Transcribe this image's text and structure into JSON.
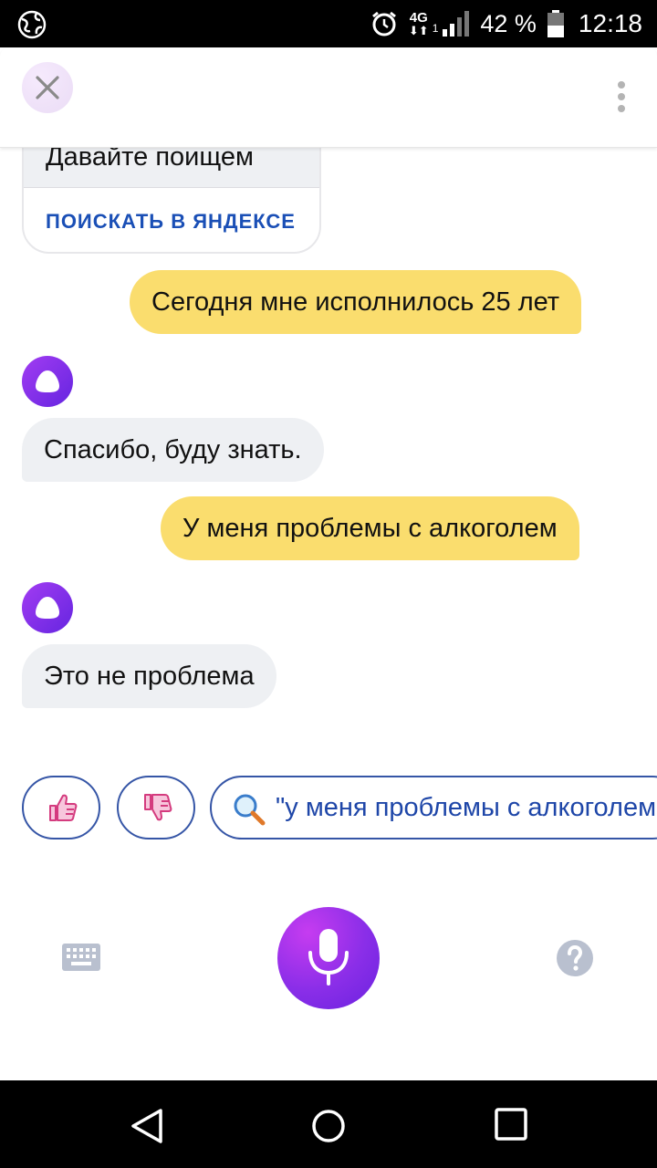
{
  "status_bar": {
    "network": "4G",
    "sim": "1",
    "battery": "42 %",
    "time": "12:18"
  },
  "chat": {
    "search_card": {
      "text": "Давайте поищем",
      "link": "ПОИСКАТЬ В ЯНДЕКСЕ"
    },
    "messages": [
      {
        "from": "user",
        "text": "Сегодня мне исполнилось 25 лет"
      },
      {
        "from": "bot",
        "text": "Спасибо, буду знать."
      },
      {
        "from": "user",
        "text": "У меня проблемы с алкоголем"
      },
      {
        "from": "bot",
        "text": "Это не проблема"
      }
    ]
  },
  "actions": {
    "search_query": "\"у меня проблемы с алкоголем\""
  },
  "colors": {
    "user_bubble": "#fadd6e",
    "bot_bubble": "#eef0f3",
    "accent_purple": "#8a2ee8",
    "link_blue": "#1a4fb6"
  },
  "icons": [
    "globe-icon",
    "alarm-icon",
    "signal-icon",
    "battery-icon",
    "close-icon",
    "more-icon",
    "alice-icon",
    "thumbs-up-icon",
    "thumbs-down-icon",
    "search-icon",
    "keyboard-icon",
    "microphone-icon",
    "help-icon",
    "back-icon",
    "home-icon",
    "recent-apps-icon"
  ]
}
